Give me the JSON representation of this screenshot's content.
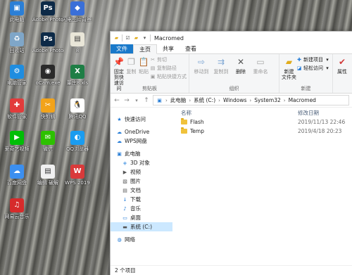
{
  "desktop": {
    "icons": [
      {
        "label": "此电脑",
        "icon": "computer-icon",
        "color": "#2b7fd6",
        "glyph": "▣"
      },
      {
        "label": "Adobe Photosho...",
        "icon": "photoshop-icon",
        "color": "#0d2a47",
        "glyph": "Ps"
      },
      {
        "label": "闪电图片背景 软件",
        "icon": "app-icon",
        "color": "#3a6fd8",
        "glyph": "◆"
      },
      {
        "label": "回收站",
        "icon": "recycle-bin-icon",
        "color": "#7fa6c8",
        "glyph": "♻"
      },
      {
        "label": "Adobe Photosho...",
        "icon": "photoshop-icon",
        "color": "#0d2a47",
        "glyph": "Ps"
      },
      {
        "label": "8",
        "icon": "document-icon",
        "color": "#e9e6d8",
        "glyph": "▤"
      },
      {
        "label": "电脑管家",
        "icon": "pc-manager-icon",
        "color": "#1f8de0",
        "glyph": "⚙"
      },
      {
        "label": "oCam.exe",
        "icon": "ocam-icon",
        "color": "#2a2a2a",
        "glyph": "◉"
      },
      {
        "label": "董庄8.xls",
        "icon": "excel-icon",
        "color": "#1e7e45",
        "glyph": "X"
      },
      {
        "label": "软件管家",
        "icon": "software-manager-icon",
        "color": "#e23b3b",
        "glyph": "✚"
      },
      {
        "label": "快剪辑",
        "icon": "video-editor-icon",
        "color": "#f2a31a",
        "glyph": "✂"
      },
      {
        "label": "腾讯QQ",
        "icon": "qq-icon",
        "color": "#ffffff",
        "glyph": "🐧"
      },
      {
        "label": "爱奇艺视频",
        "icon": "iqiyi-icon",
        "color": "#00be06",
        "glyph": "▶"
      },
      {
        "label": "微信",
        "icon": "wechat-icon",
        "color": "#2dc100",
        "glyph": "✉"
      },
      {
        "label": "QQ浏览器",
        "icon": "qq-browser-icon",
        "color": "#1a9cf0",
        "glyph": "◐"
      },
      {
        "label": "百度网盘",
        "icon": "baidu-netdisk-icon",
        "color": "#3b8ff0",
        "glyph": "☁"
      },
      {
        "label": "编辑 破解",
        "icon": "document-icon",
        "color": "#f0f0f0",
        "glyph": "▤"
      },
      {
        "label": "WPS 2019",
        "icon": "wps-icon",
        "color": "#d93a3a",
        "glyph": "W"
      },
      {
        "label": "网易云音乐",
        "icon": "netease-music-icon",
        "color": "#d62b2b",
        "glyph": "♫"
      }
    ]
  },
  "window": {
    "title": "Macromed",
    "tabs": [
      "文件",
      "主页",
      "共享",
      "查看"
    ],
    "ribbon": {
      "pin_label": "固定到快 速访问",
      "copy_label": "复制",
      "paste_label": "粘贴",
      "cut_label": "剪切",
      "copy_path_label": "复制路径",
      "paste_shortcut_label": "粘贴快捷方式",
      "clipboard_group": "剪贴板",
      "move_to_label": "移动到",
      "copy_to_label": "复制到",
      "delete_label": "删除",
      "rename_label": "重命名",
      "organize_group": "组织",
      "new_folder_label": "新建 文件夹",
      "new_item_label": "新建项目",
      "easy_access_label": "轻松访问",
      "new_group": "新建",
      "properties_label": "属性"
    },
    "address": {
      "crumbs": [
        "此电脑",
        "系统 (C:)",
        "Windows",
        "System32",
        "Macromed"
      ]
    },
    "nav": [
      {
        "label": "快速访问",
        "icon": "star-icon",
        "glyph": "★",
        "color": "#1e78d6",
        "indent": 0,
        "selected": false
      },
      {
        "label": "OneDrive",
        "icon": "onedrive-icon",
        "glyph": "☁",
        "color": "#1e78d6",
        "indent": 0,
        "selected": false
      },
      {
        "label": "WPS网盘",
        "icon": "cloud-icon",
        "glyph": "☁",
        "color": "#1e78d6",
        "indent": 0,
        "selected": false
      },
      {
        "label": "此电脑",
        "icon": "computer-icon",
        "glyph": "▣",
        "color": "#2b7fd6",
        "indent": 0,
        "selected": false
      },
      {
        "label": "3D 对象",
        "icon": "3d-objects-icon",
        "glyph": "◈",
        "color": "#5aa0e6",
        "indent": 1,
        "selected": false
      },
      {
        "label": "视频",
        "icon": "video-icon",
        "glyph": "▶",
        "color": "#555555",
        "indent": 1,
        "selected": false
      },
      {
        "label": "图片",
        "icon": "pictures-icon",
        "glyph": "▧",
        "color": "#555555",
        "indent": 1,
        "selected": false
      },
      {
        "label": "文档",
        "icon": "documents-icon",
        "glyph": "▤",
        "color": "#555555",
        "indent": 1,
        "selected": false
      },
      {
        "label": "下载",
        "icon": "download-icon",
        "glyph": "↓",
        "color": "#1e78d6",
        "indent": 1,
        "selected": false
      },
      {
        "label": "音乐",
        "icon": "music-icon",
        "glyph": "♪",
        "color": "#1e78d6",
        "indent": 1,
        "selected": false
      },
      {
        "label": "桌面",
        "icon": "desktop-icon",
        "glyph": "▭",
        "color": "#1e78d6",
        "indent": 1,
        "selected": false
      },
      {
        "label": "系统 (C:)",
        "icon": "drive-icon",
        "glyph": "▬",
        "color": "#555555",
        "indent": 1,
        "selected": true
      },
      {
        "label": "网络",
        "icon": "network-icon",
        "glyph": "◍",
        "color": "#1e78d6",
        "indent": 0,
        "selected": false
      }
    ],
    "columns": {
      "name": "名称",
      "modified": "修改日期"
    },
    "files": [
      {
        "name": "Flash",
        "modified": "2019/11/13 22:46"
      },
      {
        "name": "Temp",
        "modified": "2019/4/18 20:23"
      }
    ],
    "status": "2 个项目"
  }
}
